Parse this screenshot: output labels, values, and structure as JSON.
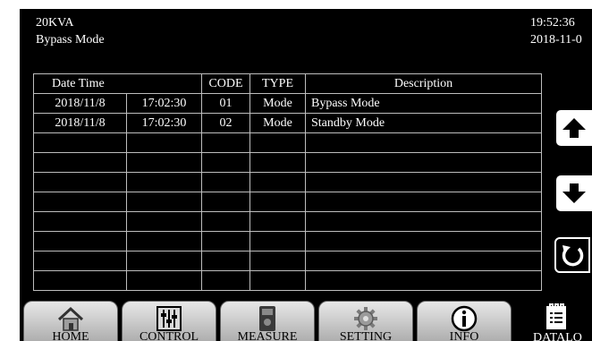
{
  "header": {
    "model": "20KVA",
    "mode": "Bypass Mode",
    "time": "19:52:36",
    "date": "2018-11-0"
  },
  "log_table": {
    "headers": {
      "date_time": "Date Time",
      "code": "CODE",
      "type": "TYPE",
      "description": "Description"
    },
    "rows": [
      {
        "date": "2018/11/8",
        "time": "17:02:30",
        "code": "01",
        "type": "Mode",
        "description": "Bypass Mode"
      },
      {
        "date": "2018/11/8",
        "time": "17:02:30",
        "code": "02",
        "type": "Mode",
        "description": "Standby Mode"
      }
    ],
    "empty_row_count": 8
  },
  "side_controls": {
    "scroll_up_icon": "up-arrow-icon",
    "scroll_down_icon": "down-arrow-icon",
    "refresh_icon": "refresh-icon"
  },
  "nav": {
    "home": "HOME",
    "control": "CONTROL",
    "measure": "MEASURE",
    "setting": "SETTING",
    "info": "INFO",
    "datalog": "DATALO"
  },
  "colors": {
    "screen_background": "#000000",
    "grid_line": "#bdbdbd",
    "text": "#ffffff"
  }
}
